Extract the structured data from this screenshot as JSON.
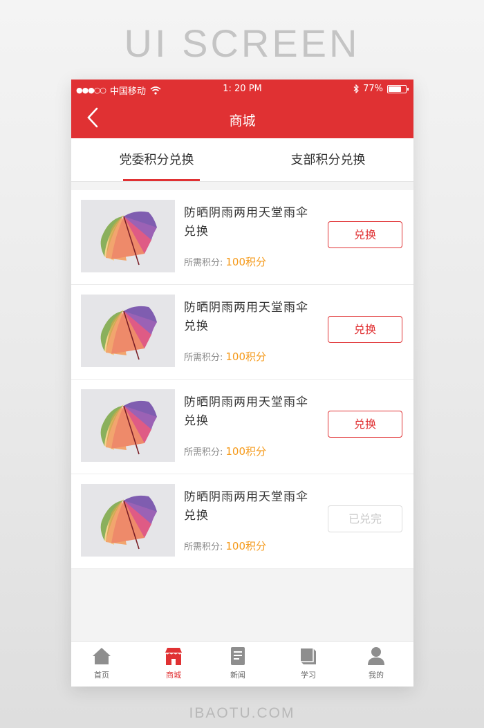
{
  "captions": {
    "top": "UI SCREEN",
    "bottom": "IBAOTU.COM"
  },
  "status_bar": {
    "carrier": "中国移动",
    "time": "1: 20 PM",
    "battery": "77%",
    "battery_level": 0.77
  },
  "header": {
    "title": "商城"
  },
  "tabs": [
    {
      "label": "党委积分兑换",
      "active": true
    },
    {
      "label": "支部积分兑换",
      "active": false
    }
  ],
  "items": [
    {
      "title": "防晒阴雨两用天堂雨伞兑换",
      "points_label": "所需积分:",
      "points_value": "100积分",
      "button": "兑换",
      "redeemed": false
    },
    {
      "title": "防晒阴雨两用天堂雨伞兑换",
      "points_label": "所需积分:",
      "points_value": "100积分",
      "button": "兑换",
      "redeemed": false
    },
    {
      "title": "防晒阴雨两用天堂雨伞兑换",
      "points_label": "所需积分:",
      "points_value": "100积分",
      "button": "兑换",
      "redeemed": false
    },
    {
      "title": "防晒阴雨两用天堂雨伞兑换",
      "points_label": "所需积分:",
      "points_value": "100积分",
      "button": "已兑完",
      "redeemed": true
    }
  ],
  "tabbar": [
    {
      "label": "首页",
      "icon": "home-icon"
    },
    {
      "label": "商城",
      "icon": "store-icon",
      "active": true
    },
    {
      "label": "新闻",
      "icon": "news-icon"
    },
    {
      "label": "学习",
      "icon": "book-icon"
    },
    {
      "label": "我的",
      "icon": "profile-icon"
    }
  ],
  "colors": {
    "brand": "#e03133",
    "points": "#f59a1b",
    "disabled": "#c8c8c8"
  }
}
